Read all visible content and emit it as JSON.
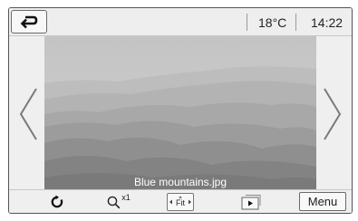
{
  "status": {
    "temperature": "18°C",
    "time": "14:22"
  },
  "photo": {
    "filename": "Blue mountains.jpg"
  },
  "toolbar": {
    "zoom_level": "x1",
    "fit_label": "Fit",
    "menu_label": "Menu"
  },
  "icons": {
    "back": "back-arrow-icon",
    "rotate": "rotate-icon",
    "zoom": "magnifier-icon",
    "fit": "fit-icon",
    "slideshow": "slideshow-icon",
    "prev": "chevron-left-icon",
    "next": "chevron-right-icon"
  }
}
